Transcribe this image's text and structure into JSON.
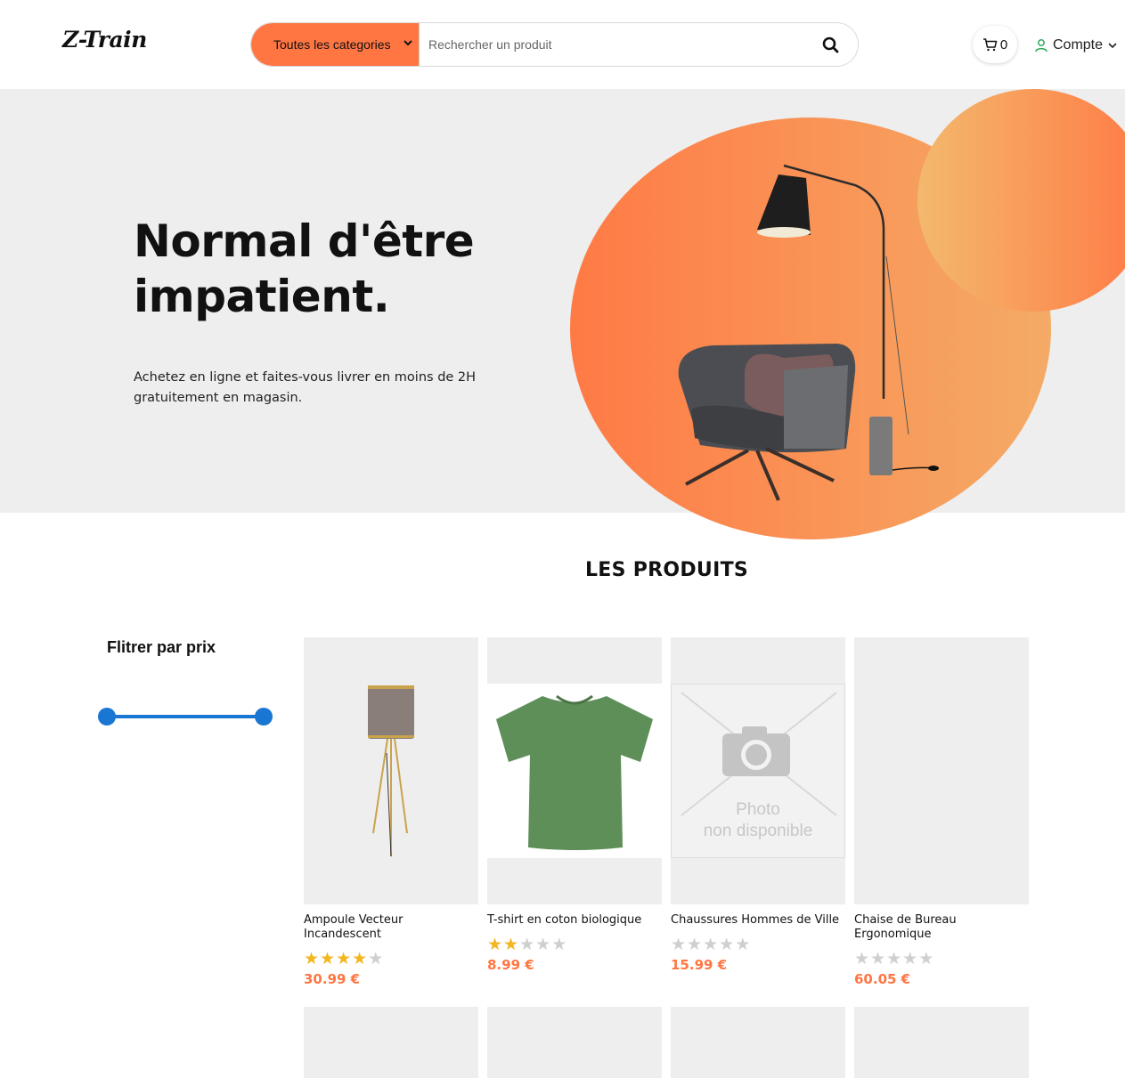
{
  "header": {
    "logo": "Z-Train",
    "category_select": "Toutes les categories",
    "search_placeholder": "Rechercher un produit",
    "cart_count": "0",
    "account_label": "Compte"
  },
  "hero": {
    "title": "Normal d'être impatient.",
    "subtitle": "Achetez en ligne et faites-vous livrer en moins de 2H gratuitement en magasin.",
    "colors": {
      "gradient_start": "#ff7a45",
      "gradient_end": "#f4ab66"
    }
  },
  "products_section": {
    "title": "LES PRODUITS",
    "filter": {
      "title": "Flitrer par prix",
      "range_min_fraction": 0,
      "range_max_fraction": 1
    },
    "products": [
      {
        "name": "Ampoule Vecteur Incandescent",
        "rating": 4,
        "price": "30.99 €",
        "image": "floor-lamp"
      },
      {
        "name": "T-shirt en coton biologique",
        "rating": 2,
        "price": "8.99 €",
        "image": "green-tshirt"
      },
      {
        "name": "Chaussures Hommes de Ville",
        "rating": 0,
        "price": "15.99 €",
        "image": "photo-unavailable",
        "image_text_line1": "Photo",
        "image_text_line2": "non disponible"
      },
      {
        "name": "Chaise de Bureau Ergonomique",
        "rating": 0,
        "price": "60.05 €",
        "image": "empty"
      }
    ]
  },
  "icons": [
    "chevron-down-icon",
    "search-icon",
    "cart-icon",
    "user-icon"
  ],
  "colors": {
    "accent": "#ff7643",
    "star": "#f3b622",
    "slider": "#1976d2"
  }
}
